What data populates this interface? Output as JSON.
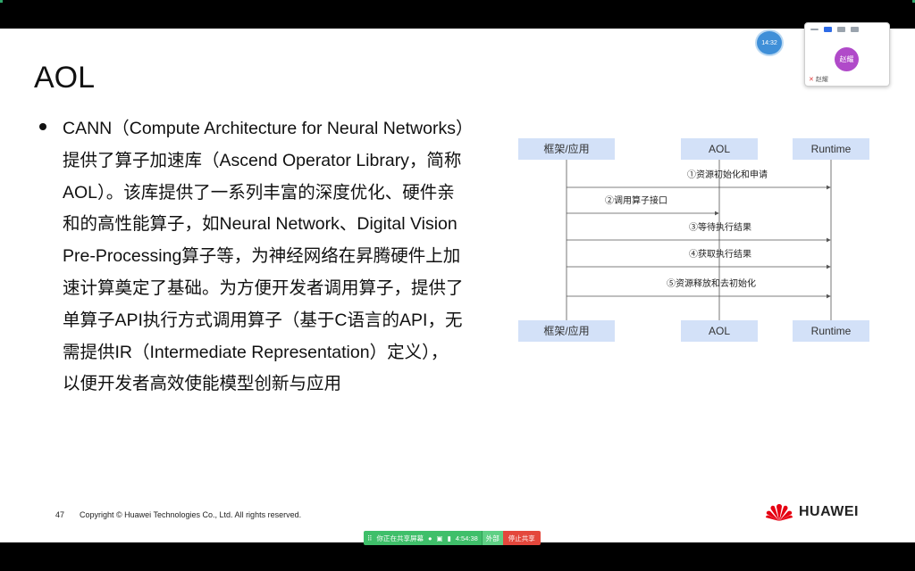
{
  "slide": {
    "title": "AOL",
    "bullet_lines": [
      "CANN（Compute Architecture for Neural Networks）",
      "提供了算子加速库（Ascend Operator Library，简称",
      "AOL）。该库提供了一系列丰富的深度优化、硬件亲",
      "和的高性能算子，如Neural Network、Digital Vision",
      "Pre-Processing算子等，为神经网络在昇腾硬件上加",
      "速计算奠定了基础。为方便开发者调用算子，提供了",
      "单算子API执行方式调用算子（基于C语言的API，无",
      "需提供IR（Intermediate Representation）定义），",
      "以便开发者高效使能模型创新与应用"
    ],
    "diagram": {
      "participants": [
        "框架/应用",
        "AOL",
        "Runtime"
      ],
      "messages": [
        "①资源初始化和申请",
        "②调用算子接口",
        "③等待执行结果",
        "④获取执行结果",
        "⑤资源释放和去初始化"
      ],
      "colors": {
        "box_fill": "#d3e1f8",
        "line": "#555555"
      }
    },
    "footer": {
      "page_number": "47",
      "copyright": "Copyright © Huawei Technologies Co., Ltd. All rights reserved.",
      "brand": "HUAWEI",
      "brand_color": "#e60012"
    }
  },
  "overlay": {
    "clock": "14:32",
    "meeting_widget": {
      "avatar_initials": "赵耀",
      "participant_name": "赵耀",
      "muted": true
    },
    "share_bar": {
      "status": "你正在共享屏幕",
      "timer": "4:54:38",
      "external": "外部",
      "stop_label": "停止共享"
    }
  }
}
